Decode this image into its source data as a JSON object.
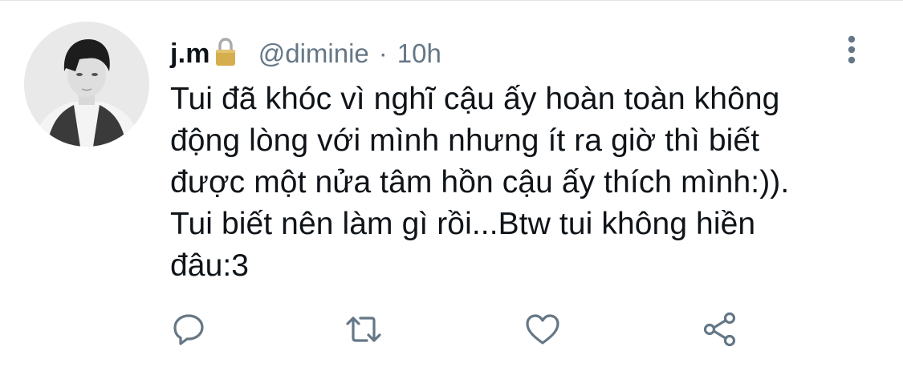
{
  "tweet": {
    "display_name": "j.m",
    "handle": "@diminie",
    "separator": "·",
    "time": "10h",
    "text": "Tui đã khóc vì nghĩ cậu ấy hoàn toàn không\nđộng lòng với mình nhưng ít ra giờ thì biết\nđược một nửa tâm hồn cậu ấy thích mình:)).\nTui biết nên làm gì rồi...Btw tui không hiền\nđâu:3"
  },
  "icons": {
    "lock": "lock-icon",
    "more": "more-vertical-icon",
    "reply": "reply-icon",
    "retweet": "retweet-icon",
    "like": "heart-icon",
    "share": "share-icon"
  },
  "colors": {
    "text": "#0f1419",
    "secondary": "#657786",
    "icon": "#657786",
    "lock_body": "#d6ae4e"
  }
}
